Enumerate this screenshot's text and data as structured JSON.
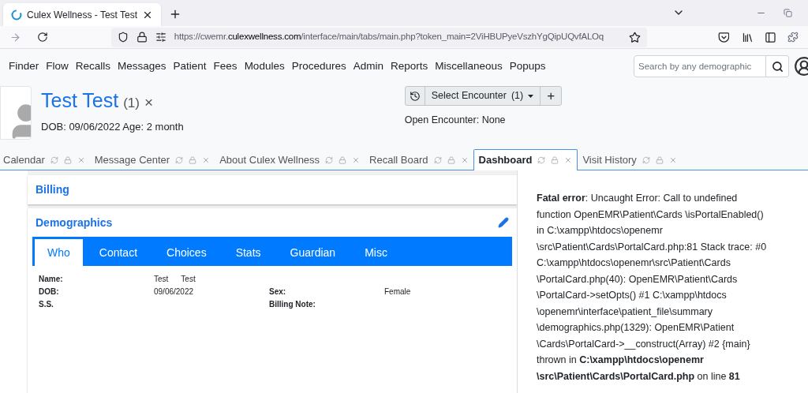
{
  "browser": {
    "tab_title": "Culex Wellness - Test Test",
    "url": {
      "prefix": "https://cwemr.",
      "domain": "culexwellness.com",
      "path": "/interface/main/tabs/main.php?token_main=2ViHBUPyeVszhYgQipUQvfALOq"
    }
  },
  "menu": [
    "Finder",
    "Flow",
    "Recalls",
    "Messages",
    "Patient",
    "Fees",
    "Modules",
    "Procedures",
    "Admin",
    "Reports",
    "Miscellaneous",
    "Popups"
  ],
  "search": {
    "placeholder": "Search by any demographic"
  },
  "patient": {
    "name": "Test Test",
    "count": "(1)",
    "close": "×",
    "dob_age": "DOB: 09/06/2022 Age: 2 month"
  },
  "encounter": {
    "select_label": "Select Encounter",
    "count": "(1)",
    "add": "+",
    "open": "Open Encounter: None"
  },
  "app_tabs": [
    {
      "label": "Calendar",
      "selected": false
    },
    {
      "label": "Message Center",
      "selected": false
    },
    {
      "label": "About Culex Wellness",
      "selected": false
    },
    {
      "label": "Recall Board",
      "selected": false
    },
    {
      "label": "Dashboard",
      "selected": true
    },
    {
      "label": "Visit History",
      "selected": false
    }
  ],
  "billing": {
    "title": "Billing"
  },
  "demographics": {
    "title": "Demographics",
    "tabs": [
      {
        "label": "Who",
        "selected": true
      },
      {
        "label": "Contact",
        "selected": false
      },
      {
        "label": "Choices",
        "selected": false
      },
      {
        "label": "Stats",
        "selected": false
      },
      {
        "label": "Guardian",
        "selected": false
      },
      {
        "label": "Misc",
        "selected": false
      }
    ],
    "rows": [
      {
        "label": "Name:",
        "values": [
          "Test",
          "Test"
        ],
        "label_2": "",
        "value_2": ""
      },
      {
        "label": "DOB:",
        "values": [
          "09/06/2022"
        ],
        "label_2": "Sex:",
        "value_2": "Female"
      },
      {
        "label": "S.S.",
        "values": [],
        "label_2": "Billing Note:",
        "value_2": ""
      }
    ]
  },
  "error": "**Fatal error**: Uncaught Error: Call to undefined function OpenEMR\\Patient\\Cards \\isPortalEnabled() in C:\\xampp\\htdocs\\openemr \\src\\Patient\\Cards\\PortalCard.php:81 Stack trace: #0 C:\\xampp\\htdocs\\openemr\\src\\Patient\\Cards \\PortalCard.php(40): OpenEMR\\Patient\\Cards \\PortalCard->setOpts() #1 C:\\xampp\\htdocs \\openemr\\interface\\patient_file\\summary \\demographics.php(1329): OpenEMR\\Patient \\Cards\\PortalCard->__construct(Array) #2 {main} thrown in **C:\\xampp\\htdocs\\openemr \\src\\Patient\\Cards\\PortalCard.php** on line **81**"
}
